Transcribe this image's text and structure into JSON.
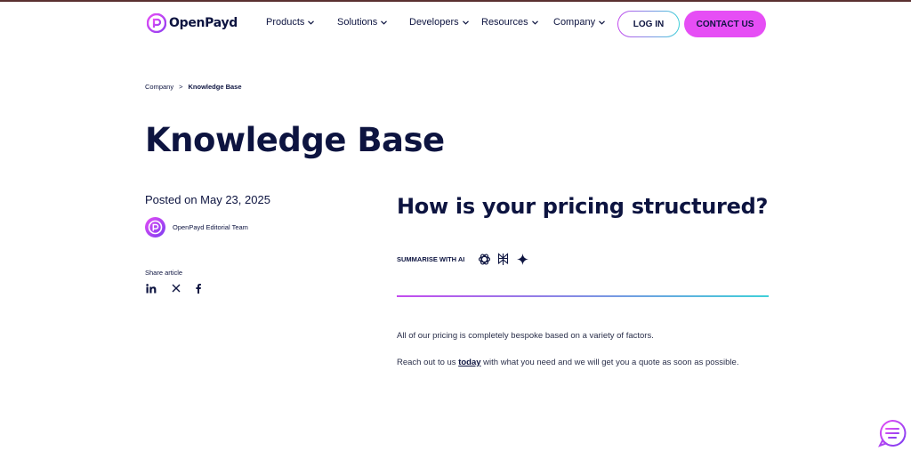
{
  "brand": {
    "name": "OpenPayd",
    "accent": "#e64ef5",
    "gradient_start": "#c44bef",
    "gradient_end": "#3fd0d9",
    "navy": "#0d1440"
  },
  "nav": {
    "items": [
      {
        "label": "Products"
      },
      {
        "label": "Solutions"
      },
      {
        "label": "Developers"
      },
      {
        "label": "Resources"
      },
      {
        "label": "Company"
      }
    ],
    "login_label": "LOG IN",
    "contact_label": "CONTACT US"
  },
  "breadcrumb": {
    "parent": "Company",
    "separator": ">",
    "current": "Knowledge Base"
  },
  "page": {
    "title": "Knowledge Base",
    "posted": "Posted on May 23, 2025",
    "author": "OpenPayd Editorial Team",
    "share_label": "Share article",
    "share_icons": [
      "linkedin-icon",
      "x-icon",
      "facebook-icon"
    ]
  },
  "article": {
    "question": "How is your pricing structured?",
    "summarise_label": "SUMMARISE WITH AI",
    "ai_icons": [
      "openai-icon",
      "perplexity-icon",
      "gemini-icon"
    ],
    "para1": "All of our pricing is completely bespoke based on a variety of factors.",
    "para2_prefix": "Reach out to us ",
    "para2_link": "today",
    "para2_suffix": " with what you need and we will get you a quote as soon as possible."
  }
}
